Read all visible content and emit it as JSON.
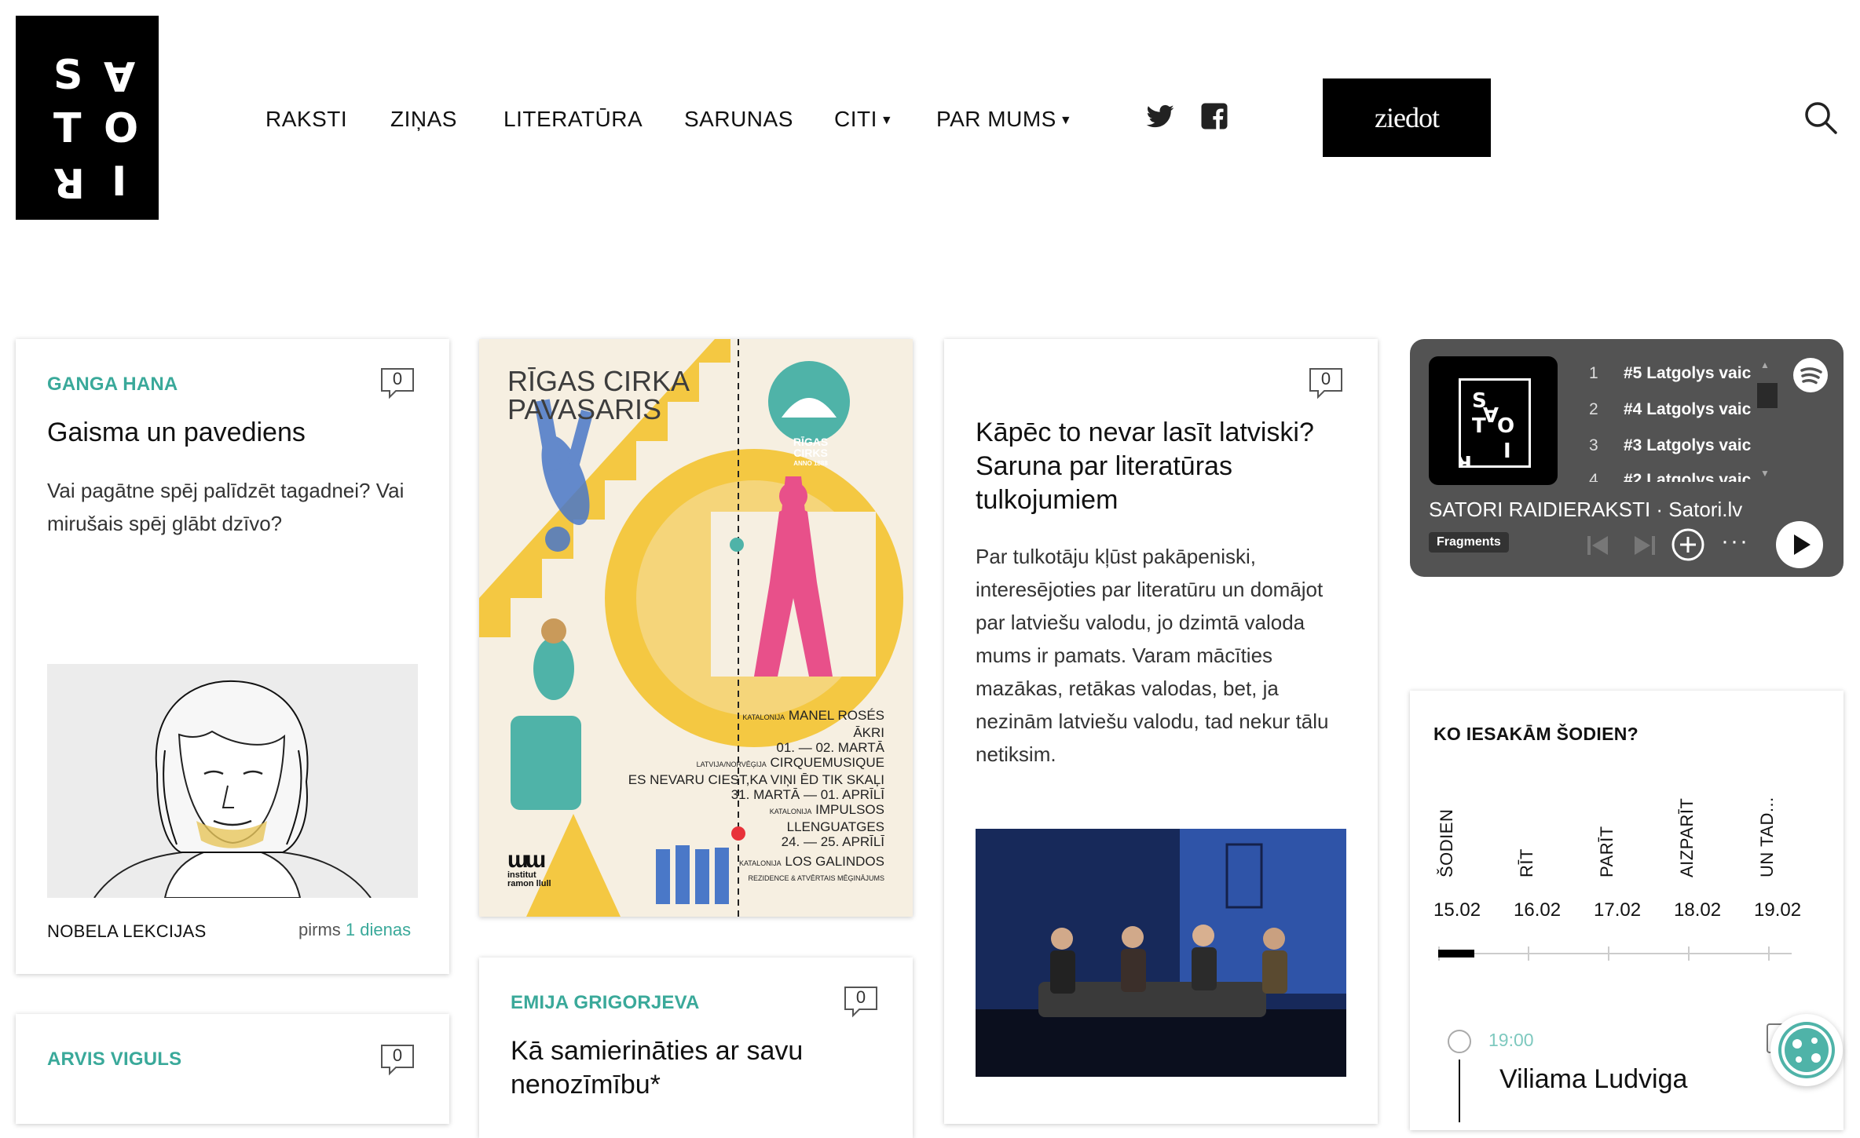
{
  "brand": {
    "logo_letters": [
      "S",
      "A",
      "T",
      "O",
      "R",
      "I"
    ]
  },
  "nav": {
    "items": [
      {
        "label": "RAKSTI"
      },
      {
        "label": "ZIŅAS"
      },
      {
        "label": "LITERATŪRA"
      },
      {
        "label": "SARUNAS"
      },
      {
        "label": "CITI",
        "has_dropdown": true
      },
      {
        "label": "PAR MUMS",
        "has_dropdown": true
      }
    ],
    "social": [
      "twitter-icon",
      "facebook-icon"
    ],
    "donate_label": "ziedot",
    "search_icon": "search-icon"
  },
  "cards": {
    "gaisma": {
      "author": "GANGA HANA",
      "comments": "0",
      "title": "Gaisma un pavediens",
      "excerpt": "Vai pagātne spēj palīdzēt tagadnei? Vai mirušais spēj glābt dzīvo?",
      "category": "NOBELA LEKCIJAS",
      "date_prefix": "pirms",
      "date_value": "1 dienas"
    },
    "arvis": {
      "author": "ARVIS VIGULS",
      "comments": "0"
    },
    "emija": {
      "author": "EMIJA GRIGORJEVA",
      "comments": "0",
      "title": "Kā samierināties ar savu nenozīmību*"
    },
    "kapec": {
      "comments": "0",
      "title": "Kāpēc to nevar lasīt latviski? Saruna par literatūras tulkojumiem",
      "excerpt": "Par tulkotāju kļūst pakāpeniski, interesējoties par literatūru un domājot par latviešu valodu, jo dzimtā valoda mums ir pamats. Varam mācīties mazākas, retākas valodas, bet, ja nezinām latviešu valodu, tad nekur tālu netiksim."
    }
  },
  "poster": {
    "title_line1": "RĪGAS CIRKA",
    "title_line2": "PAVASARIS",
    "badge_name": "RĪGAS CIRKS",
    "badge_year": "ANNO 1888",
    "events": [
      {
        "origin": "KATALONIJA",
        "name": "MANEL ROSÉS",
        "sub": "ĀKRI",
        "dates": "01. — 02. MARTĀ"
      },
      {
        "origin": "LATVIJA/NORVĒĢIJA",
        "name": "CIRQUEMUSIQUE",
        "sub": "ES NEVARU CIEST,KA VIŅI ĒD TIK SKAĻI",
        "dates": "31. MARTĀ — 01. APRĪLĪ"
      },
      {
        "origin": "KATALONIJA",
        "name": "IMPULSOS",
        "sub": "LLENGUATGES",
        "dates": "24. — 25. APRĪLĪ"
      },
      {
        "origin": "KATALONIJA",
        "name": "LOS GALINDOS",
        "sub": "REZIDENCE & ATVĒRTAIS MĒĢINĀJUMS",
        "dates": ""
      }
    ],
    "sponsor1_line1": "institut",
    "sponsor1_line2": "ramon llull"
  },
  "podcast": {
    "tracks": [
      {
        "num": "1",
        "title": "#5 Latgolys vaic"
      },
      {
        "num": "2",
        "title": "#4 Latgolys vaic"
      },
      {
        "num": "3",
        "title": "#3 Latgolys vaic"
      },
      {
        "num": "4",
        "title": "#2 Latgolys vaic"
      }
    ],
    "show_title": "SATORI RAIDIERAKSTI · Satori.lv",
    "fragment_label": "Fragments"
  },
  "schedule": {
    "heading": "KO IESAKĀM ŠODIEN?",
    "days": [
      {
        "label": "ŠODIEN",
        "date": "15.02"
      },
      {
        "label": "RĪT",
        "date": "16.02"
      },
      {
        "label": "PARĪT",
        "date": "17.02"
      },
      {
        "label": "AIZPARĪT",
        "date": "18.02"
      },
      {
        "label": "UN TAD...",
        "date": "19.02"
      }
    ],
    "event_time": "19:00",
    "event_title": "Viliama Ludviga"
  },
  "colors": {
    "accent": "#3aa99a",
    "poster_yellow": "#f4c842",
    "poster_teal": "#4fb3a8",
    "spotify_bg": "#535353"
  }
}
